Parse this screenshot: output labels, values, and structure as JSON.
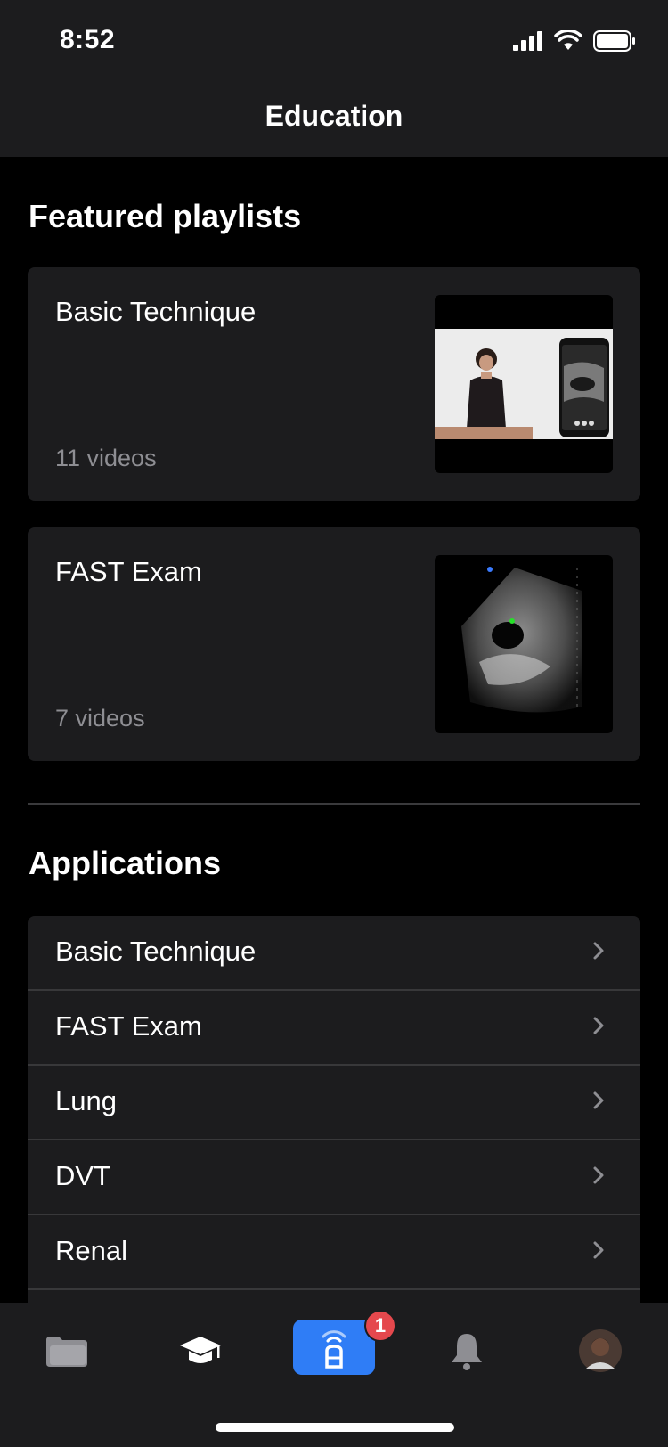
{
  "status_bar": {
    "time": "8:52"
  },
  "nav": {
    "title": "Education"
  },
  "featured": {
    "heading": "Featured playlists",
    "cards": [
      {
        "title": "Basic Technique",
        "count": "11 videos",
        "thumb_icon": "person-scanning-thumbnail"
      },
      {
        "title": "FAST Exam",
        "count": "7 videos",
        "thumb_icon": "ultrasound-thumbnail"
      }
    ]
  },
  "applications": {
    "heading": "Applications",
    "items": [
      {
        "label": "Basic Technique"
      },
      {
        "label": "FAST Exam"
      },
      {
        "label": "Lung"
      },
      {
        "label": "DVT"
      },
      {
        "label": "Renal"
      }
    ]
  },
  "tabbar": {
    "tabs": [
      {
        "icon": "folder-icon"
      },
      {
        "icon": "graduation-cap-icon",
        "active": true
      },
      {
        "icon": "probe-icon"
      },
      {
        "icon": "bell-icon"
      },
      {
        "icon": "avatar"
      }
    ],
    "badge": "1"
  },
  "colors": {
    "accent": "#2f7df6",
    "badge": "#e5484d",
    "card": "#1c1c1e",
    "secondary_text": "#8e8e93"
  }
}
